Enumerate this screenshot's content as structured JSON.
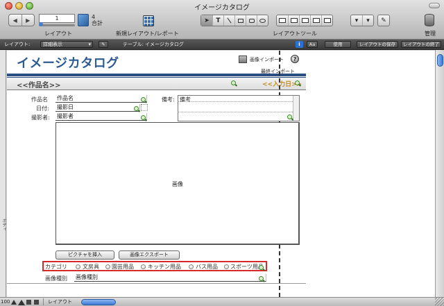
{
  "window": {
    "title": "イメージカタログ"
  },
  "toolbar": {
    "record_value": "1",
    "record_count": "4",
    "record_total_label": "合計",
    "layout_label": "レイアウト",
    "new_layout_label": "新規レイアウト/レポート",
    "layout_tools_label": "レイアウトツール",
    "manage_label": "管理"
  },
  "layoutbar": {
    "layout_prefix": "レイアウト:",
    "layout_select": "詳細表示",
    "table_prefix": "テーブル:",
    "table_name": "イメージカタログ",
    "aa_button": "Aa",
    "use_button": "使用",
    "save_layout_button": "レイアウトの保存",
    "exit_layout_button": "レイアウトの終了"
  },
  "canvas": {
    "title": "イメージカタログ",
    "import_button": "画像インポート",
    "last_import": "最終インポート",
    "help_icon": "?",
    "name_placeholder": "<<作品名>>",
    "date_placeholder": "<<入力日>>",
    "body_label": "ボディ",
    "fields": {
      "work_name_label": "作品名",
      "work_name_value": "作品名",
      "date_label": "日付:",
      "date_value": "撮影日",
      "photographer_label": "撮影者:",
      "photographer_value": "撮影者",
      "notes_label": "備考:",
      "notes_value": "備考"
    },
    "image_label": "画像",
    "insert_picture_button": "ピクチャを挿入",
    "export_image_button": "画像エクスポート",
    "category_label": "カテゴリ",
    "category_options": [
      "文房具",
      "園芸用品",
      "キッチン用品",
      "バス用品",
      "スポーツ用品"
    ],
    "image_type_label": "画像種別",
    "image_type_value": "画像種別"
  },
  "statusbar": {
    "zoom": "100",
    "mode": "レイアウト"
  },
  "colors": {
    "title_blue": "#2e5a94",
    "date_orange": "#c58a22",
    "highlight_red": "#d62a2a",
    "rule_blue": "#2a4f80"
  }
}
